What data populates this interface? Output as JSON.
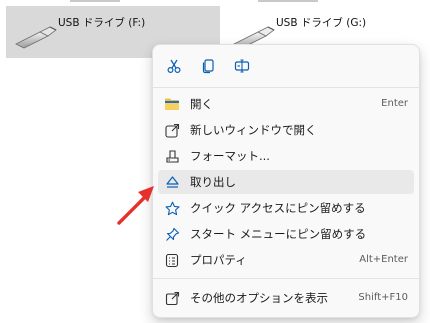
{
  "drives": [
    {
      "label": "USB ドライブ (F:)",
      "selected": true,
      "icon": "usb-drive-icon"
    },
    {
      "label": "USB ドライブ (G:)",
      "selected": false,
      "icon": "usb-drive-icon"
    }
  ],
  "menu": {
    "quick_actions": [
      {
        "name": "cut",
        "icon": "scissors-icon"
      },
      {
        "name": "copy",
        "icon": "copy-icon"
      },
      {
        "name": "rename",
        "icon": "rename-icon"
      }
    ],
    "items": [
      {
        "label": "開く",
        "shortcut": "Enter",
        "icon": "folder-icon"
      },
      {
        "label": "新しいウィンドウで開く",
        "shortcut": "",
        "icon": "open-new-window-icon"
      },
      {
        "label": "フォーマット...",
        "shortcut": "",
        "icon": "format-drive-icon"
      },
      {
        "label": "取り出し",
        "shortcut": "",
        "icon": "eject-icon"
      },
      {
        "label": "クイック アクセスにピン留めする",
        "shortcut": "",
        "icon": "star-icon"
      },
      {
        "label": "スタート メニューにピン留めする",
        "shortcut": "",
        "icon": "pin-icon"
      },
      {
        "label": "プロパティ",
        "shortcut": "Alt+Enter",
        "icon": "properties-icon"
      },
      {
        "label": "その他のオプションを表示",
        "shortcut": "Shift+F10",
        "icon": "more-options-icon"
      }
    ]
  },
  "colors": {
    "accent": "#0a5fb4",
    "folder": "#f2c037",
    "arrow": "#e8302a",
    "selection": "#d9d9d9",
    "hover": "#e9e9e9"
  }
}
